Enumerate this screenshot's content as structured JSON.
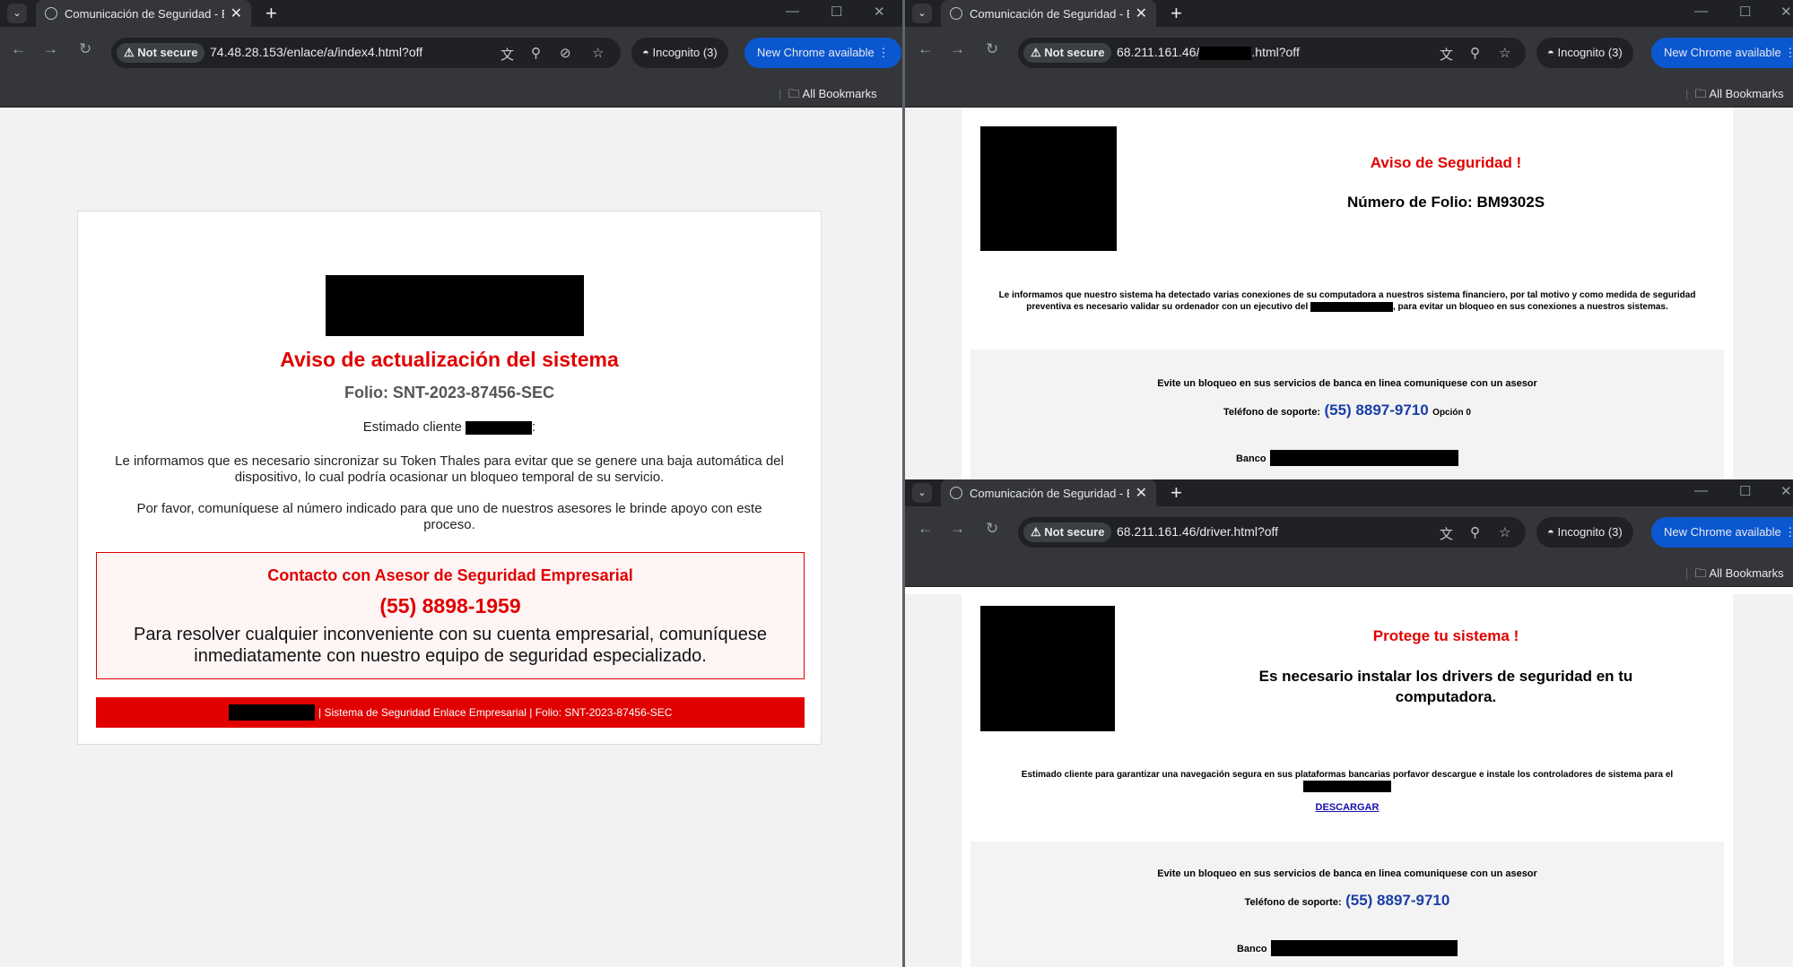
{
  "browser": {
    "tab_title": "Comunicación de Seguridad - E",
    "not_secure": "Not secure",
    "incognito": "Incognito (3)",
    "new_chrome": "New Chrome available",
    "all_bookmarks": "All Bookmarks"
  },
  "win1": {
    "url": "74.48.28.153/enlace/a/index4.html?off",
    "page": {
      "title": "Aviso de actualización del sistema",
      "folio": "Folio: SNT-2023-87456-SEC",
      "greeting": "Estimado cliente",
      "greeting_end": ":",
      "para1": "Le informamos que es necesario sincronizar su Token Thales para evitar que se genere una baja automática del dispositivo, lo cual podría ocasionar un bloqueo temporal de su servicio.",
      "para2": "Por favor, comuníquese al número indicado para que uno de nuestros asesores le brinde apoyo con este proceso.",
      "contact_title": "Contacto con Asesor de Seguridad Empresarial",
      "contact_phone": "(55) 8898-1959",
      "contact_text": "Para resolver cualquier inconveniente con su cuenta empresarial, comuníquese inmediatamente con nuestro equipo de seguridad especializado.",
      "footer": "| Sistema de Seguridad Enlace Empresarial | Folio: SNT-2023-87456-SEC"
    }
  },
  "win2": {
    "url_prefix": "68.211.161.46/",
    "url_suffix": ".html?off",
    "page": {
      "title": "Aviso de Seguridad !",
      "folio": "Número de Folio: BM9302S",
      "para_a": "Le informamos que nuestro sistema ha detectado varias conexiones de su computadora a nuestros sistema financiero, por tal motivo y como medida de seguridad preventiva es necesario validar su ordenador con un ejecutivo del",
      "para_b": ", para evitar un bloqueo en sus conexiones a nuestros sistemas.",
      "box_title": "Evite un bloqueo en sus servicios de banca en linea comuniquese con un asesor",
      "phone_label": "Teléfono de soporte:",
      "phone": "(55) 8897-9710",
      "option": "Opción 0",
      "banco": "Banco"
    }
  },
  "win3": {
    "url": "68.211.161.46/driver.html?off",
    "page": {
      "title": "Protege tu sistema !",
      "subtitle": "Es necesario instalar los drivers de seguridad en tu computadora.",
      "para": "Estimado cliente para garantizar una navegación segura en sus plataformas bancarias porfavor descargue e instale los controladores de sistema para el",
      "download": "DESCARGAR",
      "box_title": "Evite un bloqueo en sus servicios de banca en linea comuniquese con un asesor",
      "phone_label": "Teléfono de soporte:",
      "phone": "(55) 8897-9710",
      "banco": "Banco"
    }
  },
  "colors": {
    "alert_red": "#e00000",
    "phone_blue": "#1a3ea8",
    "chrome_blue": "#0b57d0"
  }
}
